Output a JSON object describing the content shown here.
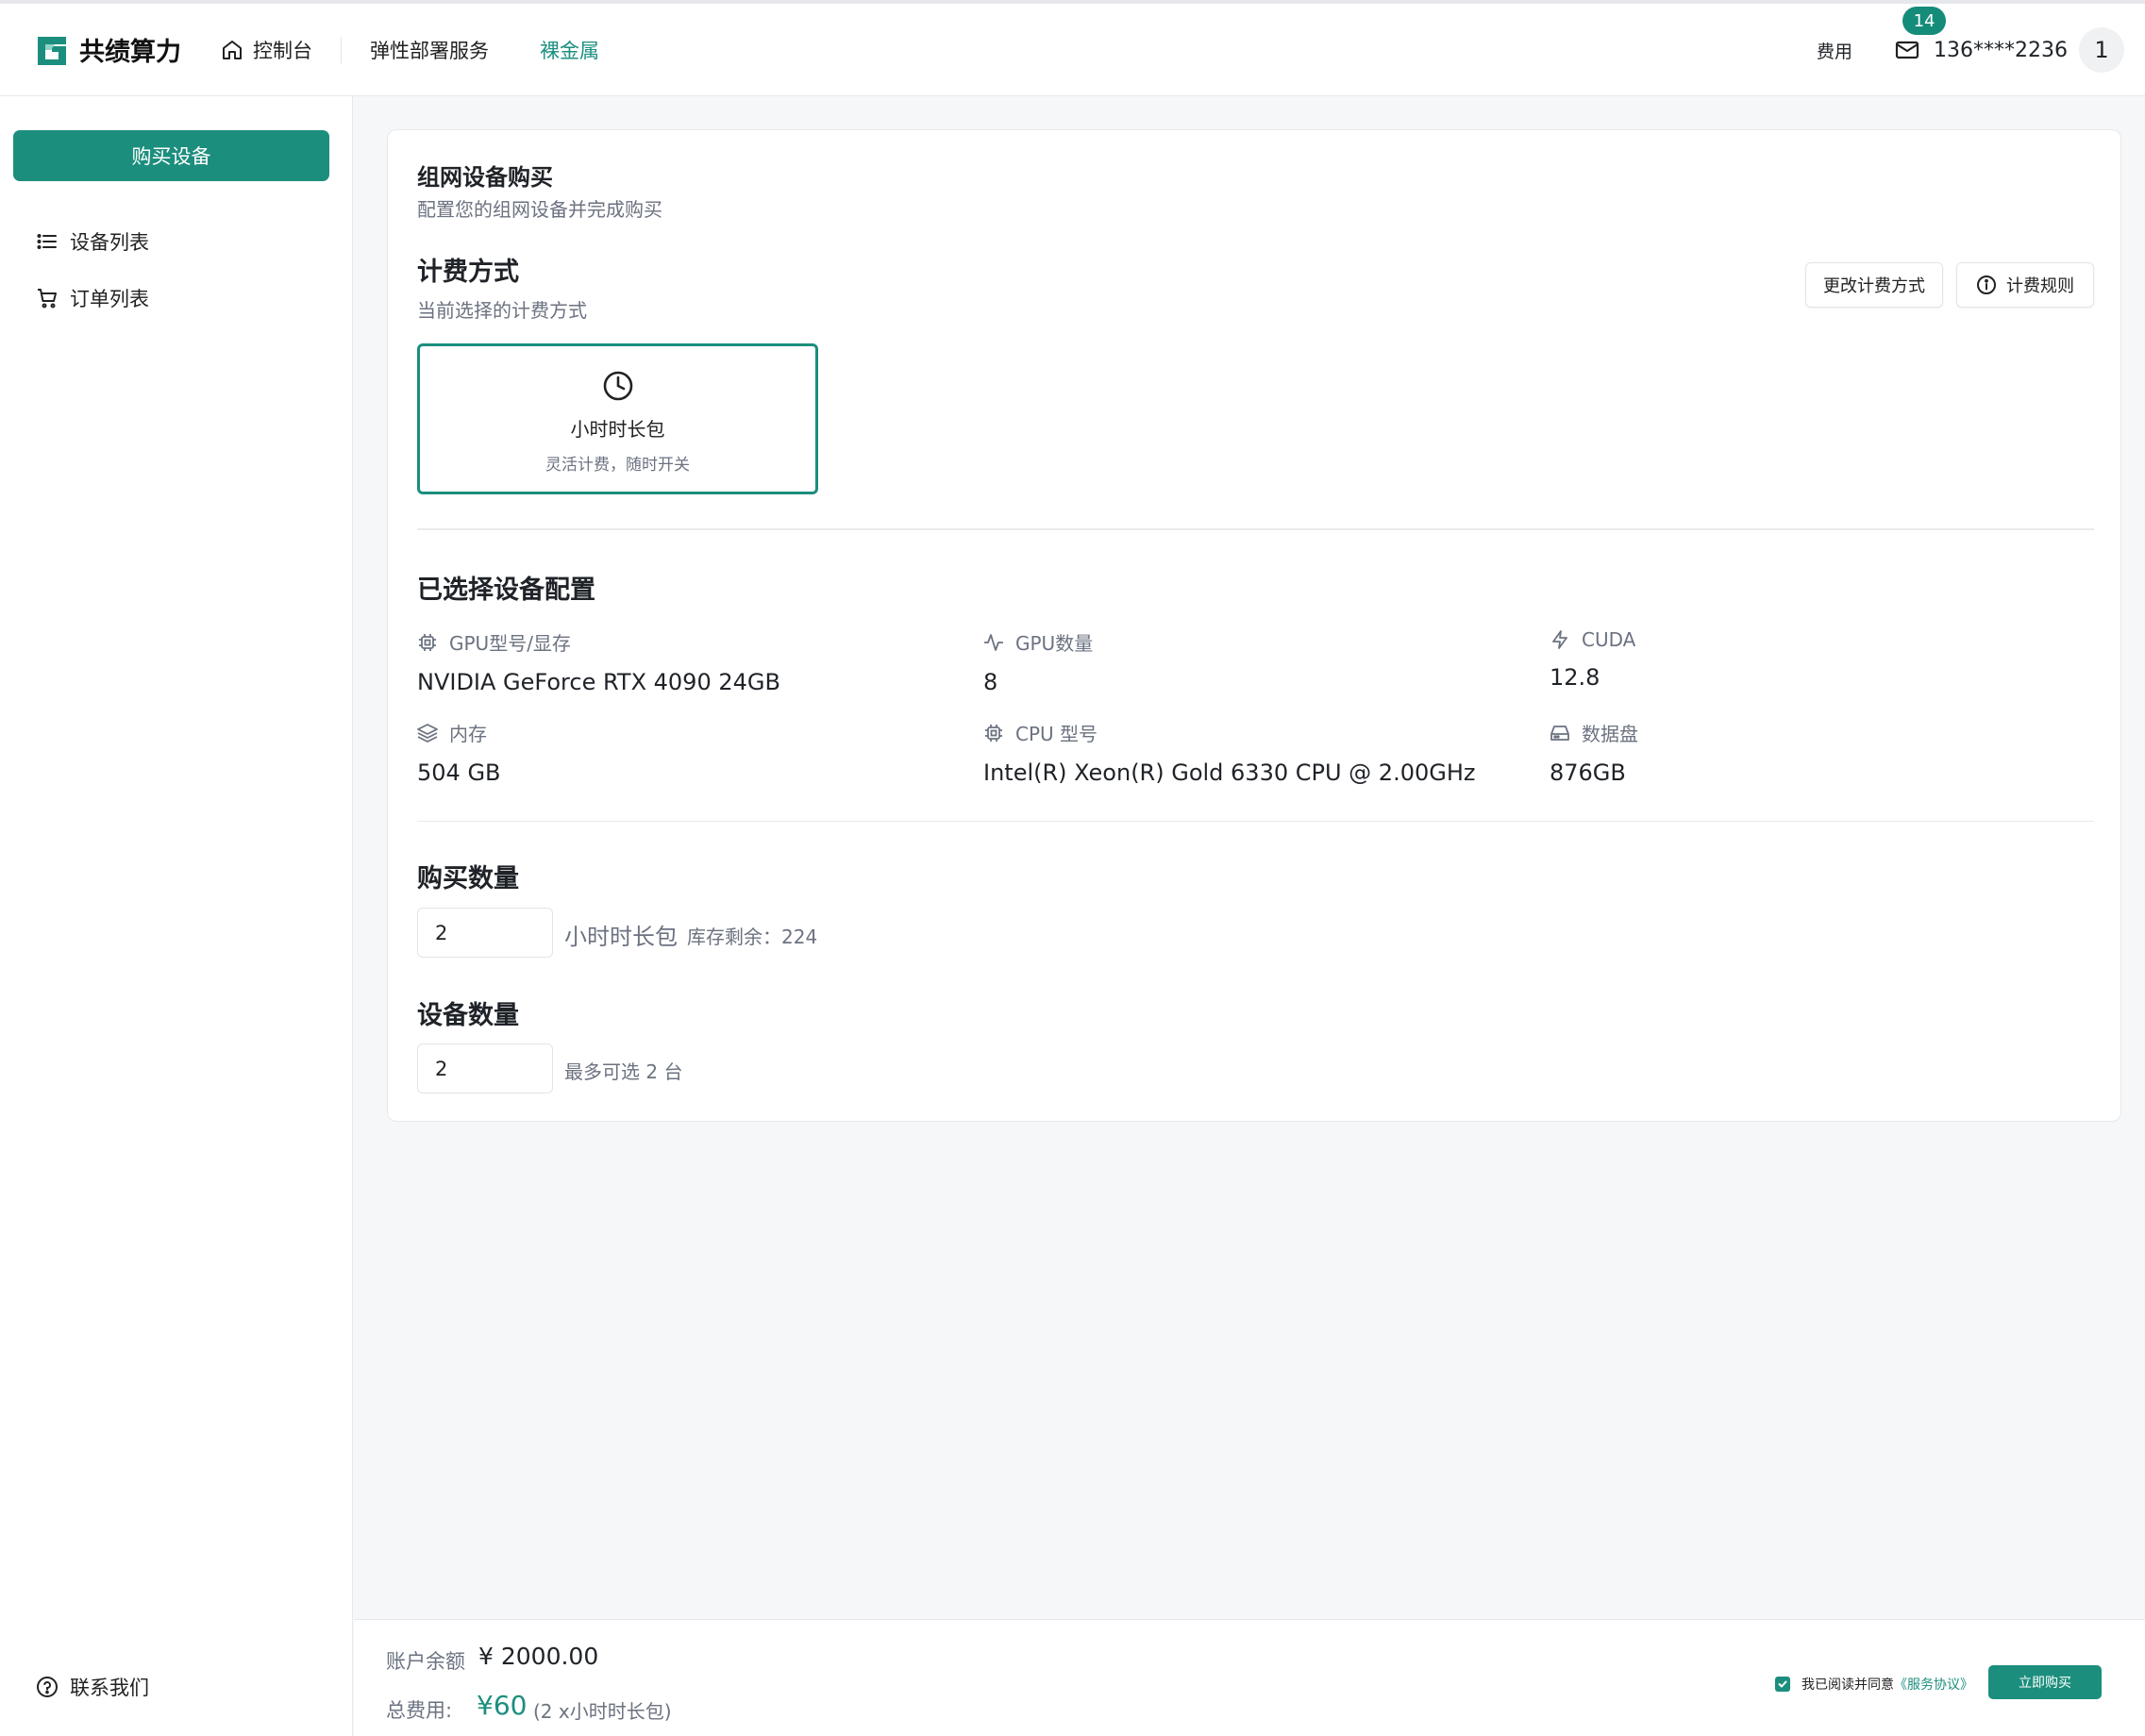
{
  "header": {
    "brand": "共绩算力",
    "nav": {
      "console": "控制台",
      "elastic": "弹性部署服务",
      "bare_metal": "裸金属"
    },
    "fee": "费用",
    "mail_badge": "14",
    "user_phone": "136****2236",
    "avatar_text": "1",
    "accent_color": "#1c8e7d"
  },
  "sidebar": {
    "buy_button": "购买设备",
    "items": [
      {
        "label": "设备列表",
        "icon": "list-icon"
      },
      {
        "label": "订单列表",
        "icon": "cart-icon"
      }
    ],
    "contact": "联系我们"
  },
  "card": {
    "title": "组网设备购买",
    "subtitle": "配置您的组网设备并完成购买",
    "billing": {
      "title": "计费方式",
      "subtitle": "当前选择的计费方式",
      "change_button": "更改计费方式",
      "rules_button": "计费规则",
      "plan_name": "小时时长包",
      "plan_desc": "灵活计费，随时开关"
    },
    "config": {
      "title": "已选择设备配置",
      "specs": [
        {
          "label": "GPU型号/显存",
          "value": "NVIDIA GeForce RTX 4090 24GB",
          "icon": "chip-icon"
        },
        {
          "label": "GPU数量",
          "value": "8",
          "icon": "activity-icon"
        },
        {
          "label": "CUDA",
          "value": "12.8",
          "icon": "lightning-icon"
        },
        {
          "label": "内存",
          "value": "504 GB",
          "icon": "layers-icon"
        },
        {
          "label": "CPU 型号",
          "value": "Intel(R) Xeon(R) Gold 6330 CPU @ 2.00GHz",
          "icon": "cpu-icon"
        },
        {
          "label": "数据盘",
          "value": "876GB",
          "icon": "harddrive-icon"
        }
      ]
    },
    "quantity": {
      "title": "购买数量",
      "value": "2",
      "unit": "小时时长包",
      "stock": "库存剩余：224"
    },
    "devices": {
      "title": "设备数量",
      "value": "2",
      "hint": "最多可选 2 台"
    }
  },
  "footer": {
    "balance_label": "账户余额",
    "balance_value": "¥ 2000.00",
    "total_label": "总费用:",
    "total_value": "¥60",
    "total_detail": "(2 x小时时长包)",
    "agree_text": "我已阅读并同意",
    "agree_link": "《服务协议》",
    "buy_now": "立即购买"
  }
}
